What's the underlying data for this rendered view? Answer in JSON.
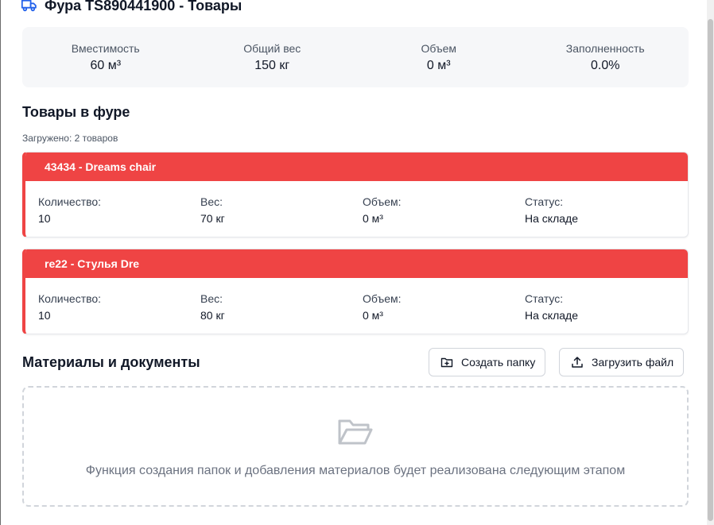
{
  "header": {
    "title": "Фура TS890441900 - Товары",
    "icon": "truck-icon",
    "close_icon": "close-icon",
    "accent": "#2563eb"
  },
  "stats": [
    {
      "label": "Вместимость",
      "value": "60 м³"
    },
    {
      "label": "Общий вес",
      "value": "150 кг"
    },
    {
      "label": "Объем",
      "value": "0 м³"
    },
    {
      "label": "Заполненность",
      "value": "0.0%"
    }
  ],
  "goods": {
    "title": "Товары в фуре",
    "loaded": "Загружено: 2 товаров",
    "status_color": "#ef4444",
    "items": [
      {
        "name": "43434 - Dreams chair",
        "fields": [
          {
            "label": "Количество:",
            "value": "10"
          },
          {
            "label": "Вес:",
            "value": "70 кг"
          },
          {
            "label": "Объем:",
            "value": "0 м³"
          },
          {
            "label": "Статус:",
            "value": "На складе"
          }
        ]
      },
      {
        "name": "re22 - Стулья Dre",
        "fields": [
          {
            "label": "Количество:",
            "value": "10"
          },
          {
            "label": "Вес:",
            "value": "80 кг"
          },
          {
            "label": "Объем:",
            "value": "0 м³"
          },
          {
            "label": "Статус:",
            "value": "На складе"
          }
        ]
      }
    ]
  },
  "documents": {
    "title": "Материалы и документы",
    "create_folder_label": "Создать папку",
    "upload_label": "Загрузить файл",
    "empty_message": "Функция создания папок и добавления материалов будет реализована следующим этапом",
    "empty_icon": "folder-open-icon"
  }
}
